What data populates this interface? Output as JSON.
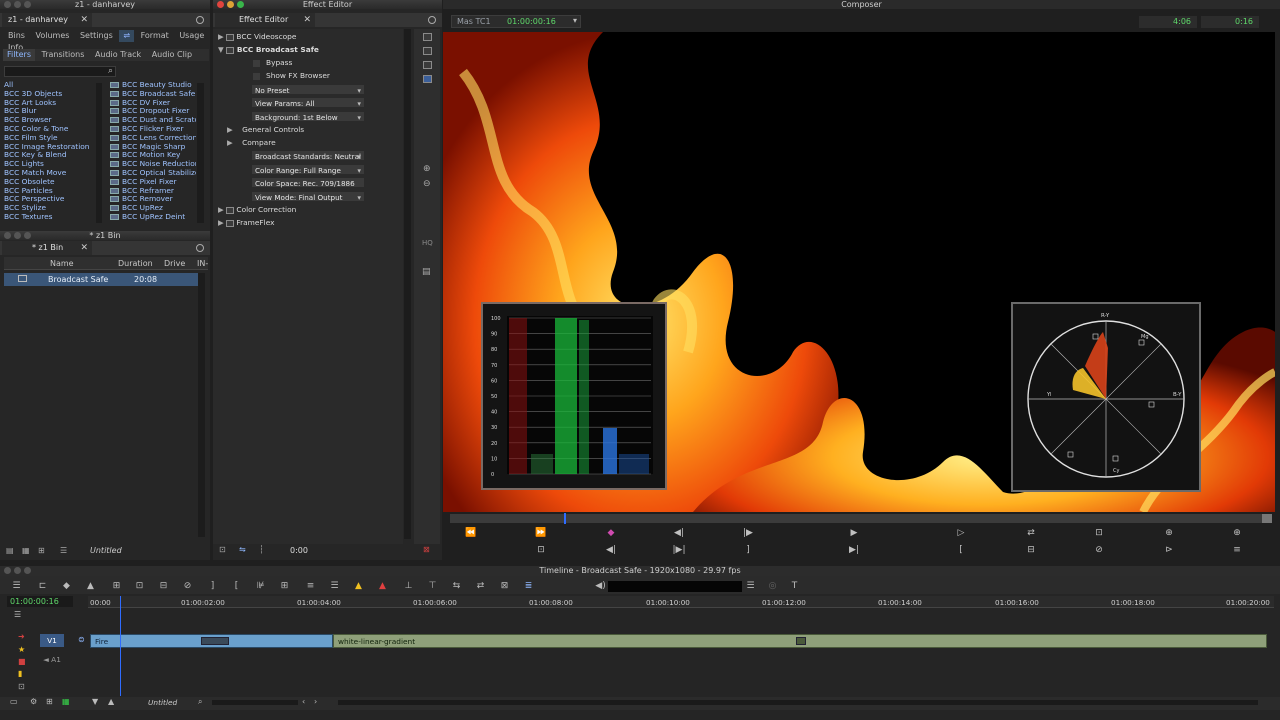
{
  "bins_window": {
    "title": "z1 - danharvey",
    "tab": "z1 - danharvey",
    "menu": [
      "Bins",
      "Volumes",
      "Settings",
      "Format",
      "Usage",
      "Info"
    ],
    "subtabs": [
      "Filters",
      "Transitions",
      "Audio Track",
      "Audio Clip"
    ],
    "categories": [
      "All",
      "BCC 3D Objects",
      "BCC Art Looks",
      "BCC Blur",
      "BCC Browser",
      "BCC Color & Tone",
      "BCC Film Style",
      "BCC Image Restoration",
      "BCC Key & Blend",
      "BCC Lights",
      "BCC Match Move",
      "BCC Obsolete",
      "BCC Particles",
      "BCC Perspective",
      "BCC Stylize",
      "BCC Textures"
    ],
    "effects": [
      "BCC Beauty Studio",
      "BCC Broadcast Safe",
      "BCC DV Fixer",
      "BCC Dropout Fixer",
      "BCC Dust and Scratch",
      "BCC Flicker Fixer",
      "BCC Lens Correction",
      "BCC Magic Sharp",
      "BCC Motion Key",
      "BCC Noise Reduction",
      "BCC Optical Stabilizer",
      "BCC Pixel Fixer",
      "BCC Reframer",
      "BCC Remover",
      "BCC UpRez",
      "BCC UpRez Deint"
    ]
  },
  "bin2": {
    "title": "* z1 Bin",
    "tab": "* z1 Bin",
    "columns": [
      "Name",
      "Duration",
      "Drive",
      "IN-"
    ],
    "rows": [
      {
        "name": "Broadcast Safe",
        "duration": "20:08"
      }
    ],
    "footer_label": "Untitled"
  },
  "effect_editor": {
    "title": "Effect Editor",
    "tab": "Effect Editor",
    "tree": {
      "videoscope": "BCC Videoscope",
      "broadcast_safe": "BCC Broadcast Safe",
      "bypass": "Bypass",
      "show_fx": "Show FX Browser",
      "preset": "No Preset",
      "view_params": "View Params: All",
      "background": "Background: 1st Below",
      "general_controls": "General Controls",
      "compare": "Compare",
      "standards": "Broadcast Standards: Neutral",
      "color_range": "Color Range: Full Range",
      "color_space": "Color Space: Rec. 709/1886 (HD",
      "view_mode": "View Mode: Final Output",
      "color_correction": "Color Correction",
      "frameflex": "FrameFlex"
    },
    "timecode": "0:00",
    "side_label": "HQ"
  },
  "composer": {
    "title": "Composer",
    "source_label": "Mas TC1",
    "timecode": "01:00:00:16",
    "tc_right1": "4:06",
    "tc_right2": "0:16",
    "waveform_ticks": [
      "100",
      "90",
      "80",
      "70",
      "60",
      "50",
      "40",
      "30",
      "20",
      "10",
      "0"
    ],
    "vectorscope_labels": {
      "ry": "R-Y",
      "by": "B-Y",
      "cy": "Cy",
      "mg": "Mg",
      "yl": "Yl"
    }
  },
  "timeline": {
    "title": "Timeline - Broadcast Safe - 1920x1080 - 29.97 fps",
    "position_tc": "01:00:00:16",
    "ruler": [
      "00:00",
      "01:00:02:00",
      "01:00:04:00",
      "01:00:06:00",
      "01:00:08:00",
      "01:00:10:00",
      "01:00:12:00",
      "01:00:14:00",
      "01:00:16:00",
      "01:00:18:00",
      "01:00:20:00"
    ],
    "tracks": [
      "V1",
      "A1"
    ],
    "clip1": "Fire",
    "clip2": "white-linear-gradient",
    "footer_label": "Untitled"
  },
  "colors": {
    "accent_green": "#37d64a",
    "timecode_green": "#5fd86a",
    "selection": "#3a6ea8"
  }
}
